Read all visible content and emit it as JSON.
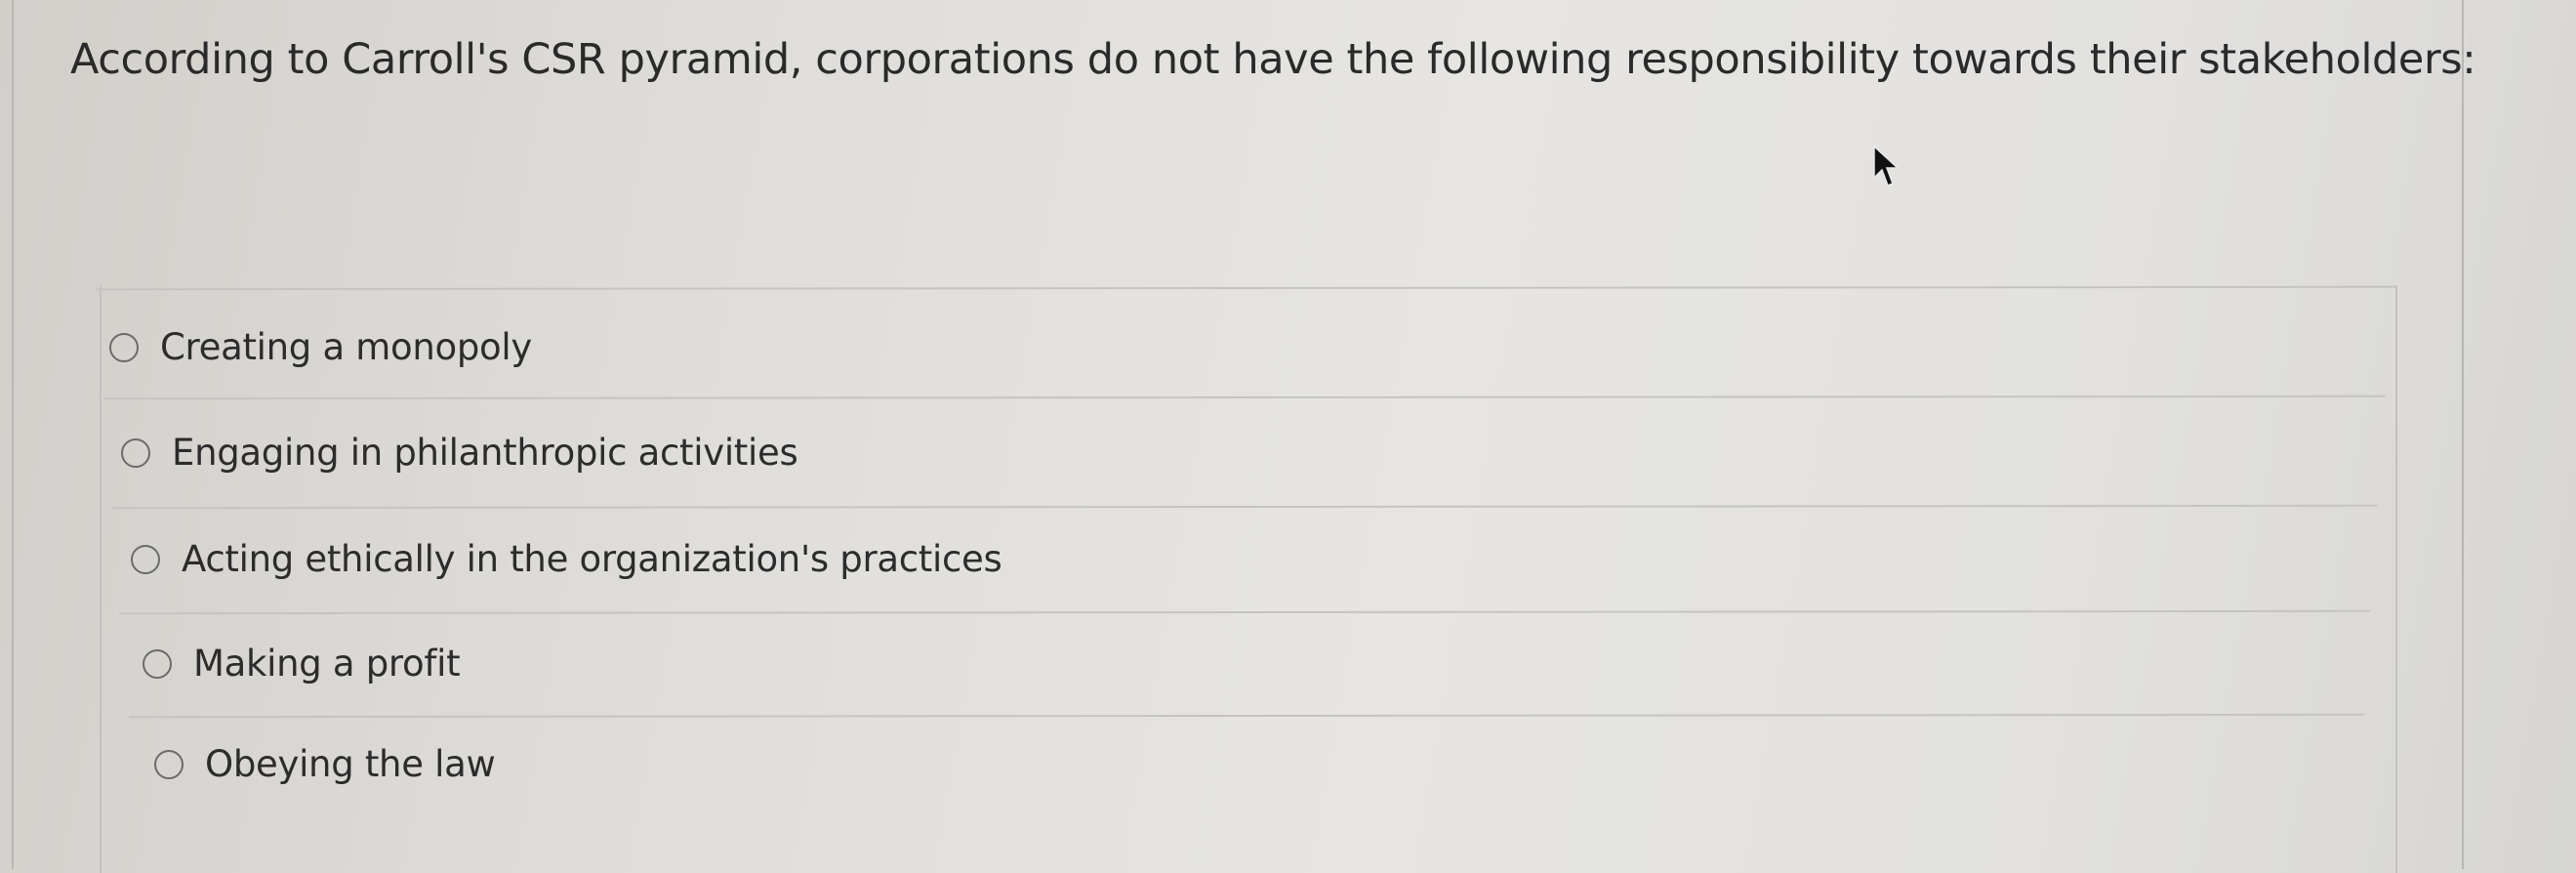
{
  "question": {
    "text": "According to Carroll's CSR pyramid, corporations do not have the following responsibility towards their stakeholders:"
  },
  "options": [
    {
      "label": "Creating a monopoly",
      "selected": false
    },
    {
      "label": "Engaging in philanthropic activities",
      "selected": false
    },
    {
      "label": "Acting ethically in the organization's practices",
      "selected": false
    },
    {
      "label": "Making a profit",
      "selected": false
    },
    {
      "label": "Obeying the law",
      "selected": false
    }
  ],
  "colors": {
    "text": "#2b2b2b",
    "radio_border": "#6b6b6b",
    "divider": "#c6c4c1"
  }
}
